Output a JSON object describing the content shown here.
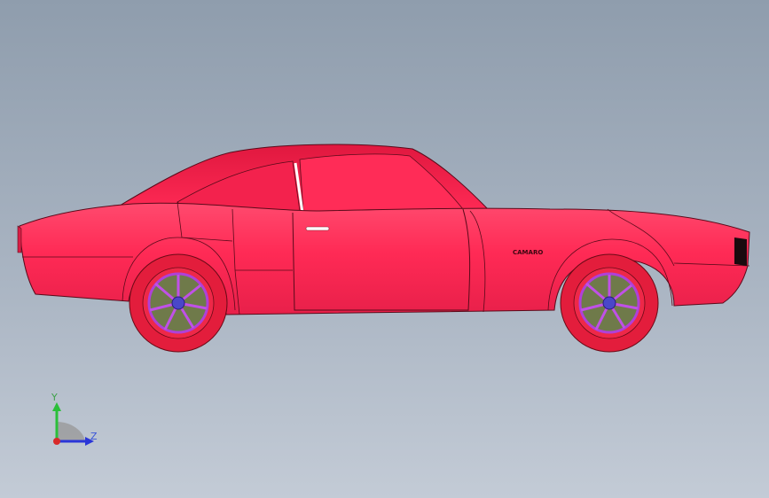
{
  "viewport": {
    "background_top": "#8f9dad",
    "background_bottom": "#c3cbd6"
  },
  "model": {
    "body_color": "#ff2a55",
    "tire_color": "#e31d3c",
    "rim_color": "#b040d8",
    "hub_color": "#4a47c8",
    "disc_color": "#6f7a4a",
    "badge_text": "CAMARO"
  },
  "triad": {
    "y_label": "Y",
    "z_label": "Z",
    "y_color": "#2bbf3a",
    "z_color": "#2a36d8",
    "x_color": "#d82a2a"
  }
}
